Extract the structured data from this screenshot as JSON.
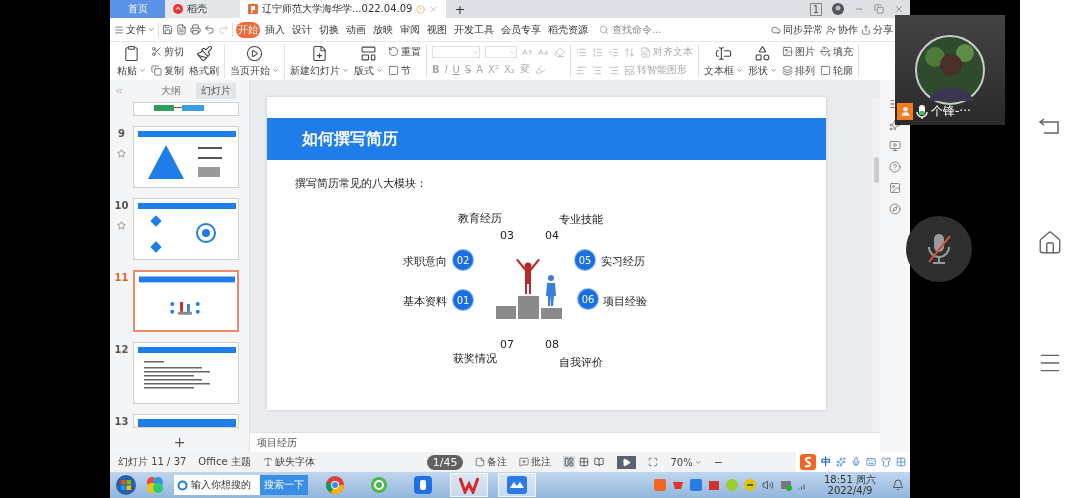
{
  "tabs": [
    {
      "label": "首页",
      "kind": "home",
      "selected": false
    },
    {
      "label": "稻壳",
      "kind": "docer",
      "selected": false
    },
    {
      "label": "辽宁师范大学海华学...022.04.09",
      "kind": "document",
      "selected": true
    }
  ],
  "new_tab": "+",
  "account_badge": "1",
  "menu": {
    "file": "文件",
    "tabs": [
      {
        "label": "开始",
        "selected": true
      },
      {
        "label": "插入",
        "selected": false
      },
      {
        "label": "设计",
        "selected": false
      },
      {
        "label": "切换",
        "selected": false
      },
      {
        "label": "动画",
        "selected": false
      },
      {
        "label": "放映",
        "selected": false
      },
      {
        "label": "审阅",
        "selected": false
      },
      {
        "label": "视图",
        "selected": false
      },
      {
        "label": "开发工具",
        "selected": false
      },
      {
        "label": "会员专享",
        "selected": false
      },
      {
        "label": "稻壳资源",
        "selected": false
      }
    ],
    "search": {
      "placeholder": "查找命令..."
    },
    "actions": [
      "同步异常",
      "协作",
      "分享"
    ]
  },
  "ribbon": [
    {
      "items": [
        {
          "kind": "large",
          "label": "粘贴",
          "caret": true
        },
        {
          "kind": "stack",
          "labels": [
            "剪切",
            "复制"
          ]
        },
        {
          "kind": "large",
          "label": "格式刷",
          "caret": false
        }
      ]
    },
    {
      "items": [
        {
          "kind": "large",
          "label": "当页开始",
          "caret": true
        }
      ]
    },
    {
      "items": [
        {
          "kind": "large",
          "label": "新建幻灯片",
          "caret": true
        },
        {
          "kind": "large",
          "label": "版式",
          "caret": true
        },
        {
          "kind": "stack",
          "labels": [
            "重置",
            "节"
          ]
        }
      ]
    },
    {
      "items": [
        {
          "kind": "font",
          "marks": [
            "B",
            "I",
            "U",
            "S",
            "A",
            "X²",
            "X₂",
            "変"
          ]
        }
      ]
    },
    {
      "items": [
        {
          "kind": "paragraph",
          "labels": [
            "对齐文本",
            "转智能图形"
          ]
        }
      ]
    },
    {
      "items": [
        {
          "kind": "large",
          "label": "文本框",
          "caret": true
        },
        {
          "kind": "large",
          "label": "形状",
          "caret": true
        },
        {
          "kind": "stack",
          "labels": [
            "图片",
            "排列"
          ]
        },
        {
          "kind": "stack",
          "labels": [
            "填充",
            "轮廓"
          ]
        }
      ]
    }
  ],
  "panel": {
    "tabs": [
      {
        "label": "大纲",
        "selected": false
      },
      {
        "label": "幻灯片",
        "selected": true
      }
    ],
    "thumbnails": [
      {
        "kind": "partial",
        "starred": false,
        "selected": false
      },
      {
        "kind": "full",
        "number": "9",
        "starred": true,
        "selected": false
      },
      {
        "kind": "full",
        "number": "10",
        "starred": true,
        "selected": false
      },
      {
        "kind": "full",
        "number": "11",
        "starred": false,
        "selected": true
      },
      {
        "kind": "full",
        "number": "12",
        "starred": false,
        "selected": false
      },
      {
        "kind": "partial",
        "number": "13",
        "starred": false,
        "selected": false
      }
    ],
    "add": "+"
  },
  "slide": {
    "title": "如何撰写简历",
    "subtitle": "撰写简历常见的八大模块：",
    "modules": [
      {
        "kind": "plain",
        "number": "03",
        "label": "教育经历"
      },
      {
        "kind": "plain",
        "number": "04",
        "label": "专业技能"
      },
      {
        "kind": "badge",
        "number": "02",
        "label": "求职意向"
      },
      {
        "kind": "badge",
        "number": "05",
        "label": "实习经历"
      },
      {
        "kind": "badge",
        "number": "01",
        "label": "基本资料"
      },
      {
        "kind": "badge",
        "number": "06",
        "label": "项目经验"
      },
      {
        "kind": "plain",
        "number": "07",
        "label": "获奖情况"
      },
      {
        "kind": "plain",
        "number": "08",
        "label": "自我评价"
      }
    ]
  },
  "notes": [
    "项目经历"
  ],
  "status": {
    "slide_count": "幻灯片 11 / 37",
    "theme": "Office 主题",
    "missing_fonts": "缺失字体",
    "page_counter": "1/45",
    "notes": "备注",
    "comments": "批注",
    "views": [
      {
        "selected": true
      },
      {
        "selected": false
      },
      {
        "selected": false
      }
    ],
    "zoom": "70%",
    "zoom_out": "−",
    "ime": "中"
  },
  "taskbar": {
    "search": {
      "placeholder": "输入你想搜的",
      "button": "搜索一下"
    },
    "time": "18:51 周六",
    "date": "2022/4/9"
  },
  "call": {
    "name": "个锋-···",
    "mic_muted": true
  }
}
